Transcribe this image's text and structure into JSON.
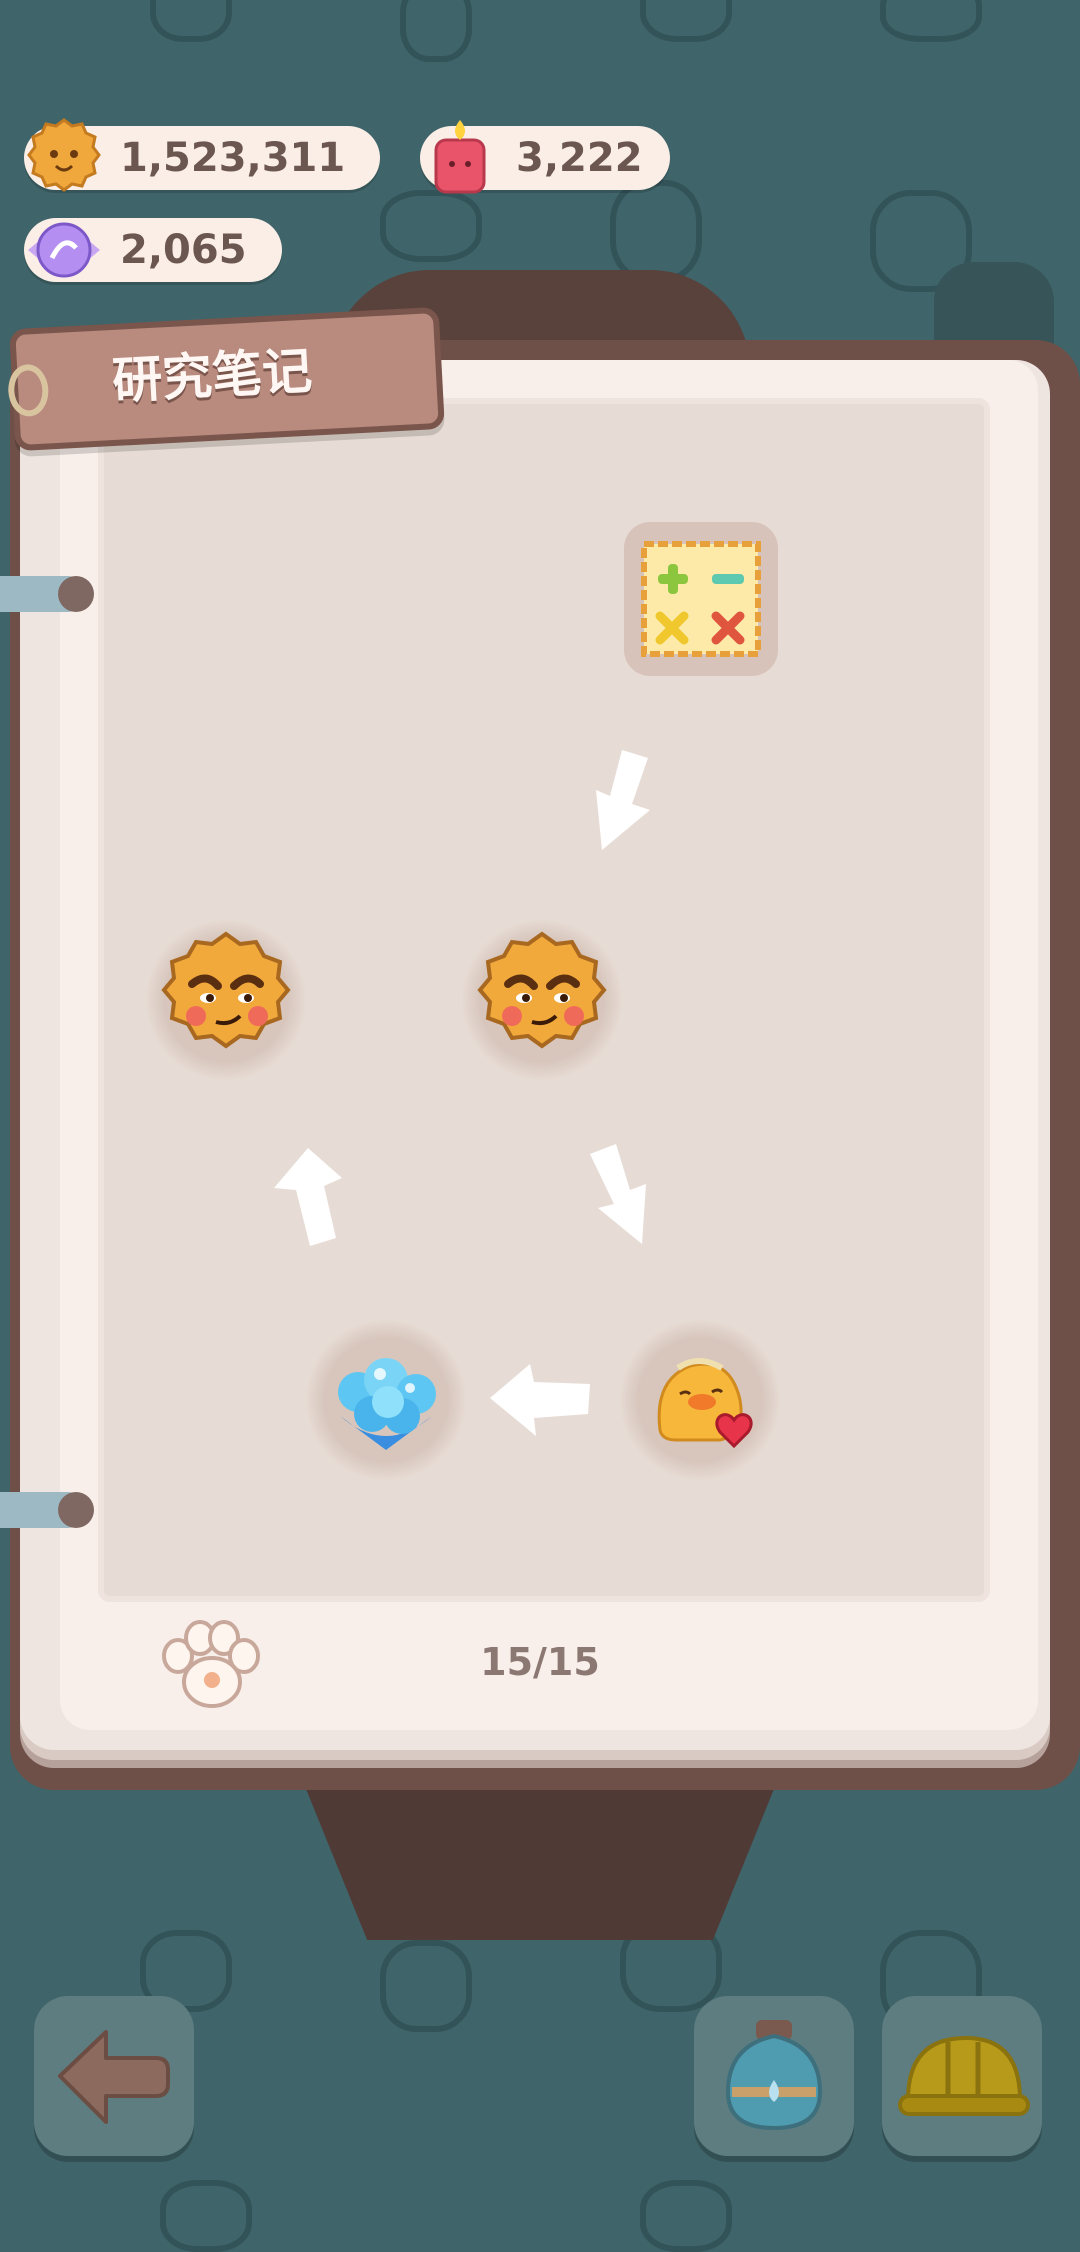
{
  "currencies": {
    "cookies": "1,523,311",
    "candles": "3,222",
    "gems": "2,065"
  },
  "notebook": {
    "title": "研究笔记",
    "page_counter": "15/15"
  },
  "colors": {
    "background": "#3f6469",
    "book_brown": "#6e5049",
    "page": "#e7dcd5"
  },
  "icons": {
    "cookie_currency": "cookie-icon",
    "candle_currency": "candle-icon",
    "gem_currency": "gem-candy-icon",
    "recipe": "math-stamp-icon",
    "cookie_face": "grumpy-cookie-icon",
    "bubbles": "blue-bubbles-icon",
    "chick": "chick-with-heart-icon",
    "paw": "paw-icon",
    "back": "back-arrow-icon",
    "potion": "potion-bottle-icon",
    "helmet": "hard-hat-icon"
  }
}
